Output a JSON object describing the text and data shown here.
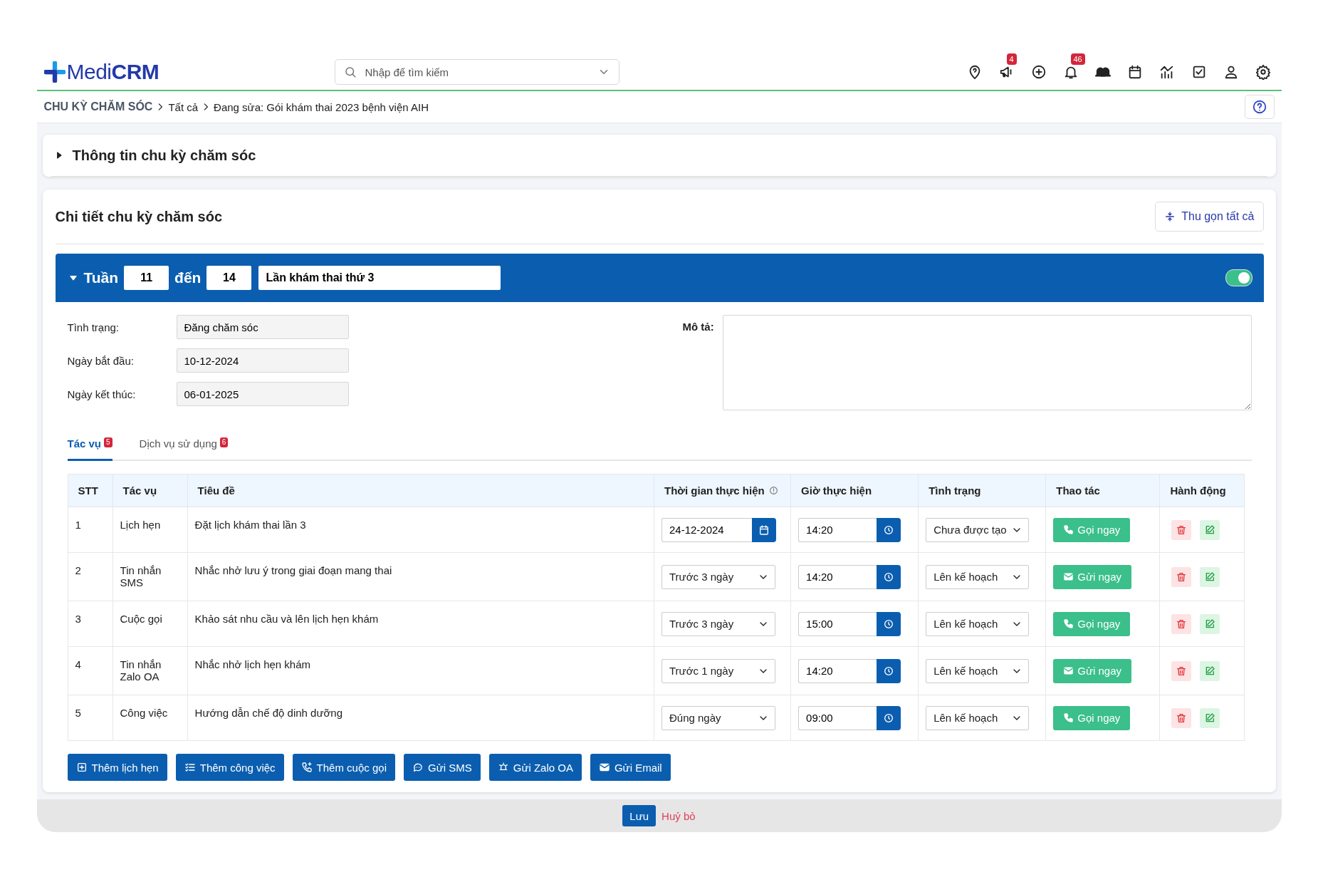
{
  "header": {
    "logo": "Medi**CRM**",
    "search": {
      "placeholder": "Nhập để tìm kiếm"
    },
    "announcement_badge": "4",
    "notification_badge": "46"
  },
  "breadcrumb": [
    {
      "text": "CHU KỲ CHĂM SÓC",
      "kind": "root"
    },
    {
      "text": "Tất cả",
      "kind": "link"
    },
    {
      "text": "Đang sửa: Gói khám thai 2023 bệnh viện AIH",
      "kind": "current"
    }
  ],
  "info_section": {
    "title": "Thông tin chu kỳ chăm sóc",
    "expanded": false
  },
  "detail_section": {
    "title": "Chi tiết chu kỳ chăm sóc",
    "collapse_button": "Thu gọn tất cả"
  },
  "stage": {
    "expanded": true,
    "week_label": "Tuần",
    "from_week": "11",
    "to_label": "đến",
    "to_week": "14",
    "name": "Lần khám thai thứ 3",
    "on": true,
    "fields": [
      {
        "label": "Tình trạng:",
        "value": "Đăng chăm sóc"
      },
      {
        "label": "Ngày bắt đầu:",
        "value": "10-12-2024"
      },
      {
        "label": "Ngày kết thúc:",
        "value": "06-01-2025"
      }
    ],
    "description_label": "Mô tả:"
  },
  "tabs": [
    {
      "label": "Tác vụ",
      "badge": "5",
      "selected": true
    },
    {
      "label": "Dịch vụ sử dụng",
      "badge": "6",
      "selected": false
    }
  ],
  "table": {
    "columns": [
      "STT",
      "Tác vụ",
      "Tiêu đề",
      "Thời gian thực hiện",
      "Giờ thực hiện",
      "Tình trạng",
      "Thao tác",
      "Hành động"
    ],
    "rows": [
      {
        "stt": "1",
        "task": "Lịch hẹn",
        "title": "Đặt lịch khám thai lần 3",
        "time": {
          "kind": "date",
          "value": "24-12-2024"
        },
        "hour": "14:20",
        "status": "Chưa được tạo",
        "action": {
          "kind": "call",
          "label": "Gọi ngay"
        }
      },
      {
        "stt": "2",
        "task": "Tin nhắn SMS",
        "title": "Nhắc nhở lưu ý trong giai đoạn mang thai",
        "time": {
          "kind": "select",
          "value": "Trước 3 ngày"
        },
        "hour": "14:20",
        "status": "Lên kế hoạch",
        "action": {
          "kind": "send",
          "label": "Gửi ngay"
        }
      },
      {
        "stt": "3",
        "task": "Cuộc gọi",
        "title": "Khảo sát nhu cầu và lên lịch hẹn khám",
        "time": {
          "kind": "select",
          "value": "Trước 3 ngày"
        },
        "hour": "15:00",
        "status": "Lên kế hoạch",
        "action": {
          "kind": "call",
          "label": "Gọi ngay"
        }
      },
      {
        "stt": "4",
        "task": "Tin nhắn Zalo OA",
        "title": "Nhắc nhở lịch hẹn khám",
        "time": {
          "kind": "select",
          "value": "Trước 1 ngày"
        },
        "hour": "14:20",
        "status": "Lên kế hoạch",
        "action": {
          "kind": "send",
          "label": "Gửi ngay"
        }
      },
      {
        "stt": "5",
        "task": "Công việc",
        "title": "Hướng dẫn chế độ dinh dưỡng",
        "time": {
          "kind": "select",
          "value": "Đúng ngày"
        },
        "hour": "09:00",
        "status": "Lên kế hoạch",
        "action": {
          "kind": "call",
          "label": "Gọi ngay"
        }
      }
    ]
  },
  "add_buttons": [
    {
      "kind": "appointment",
      "label": "Thêm lịch hẹn"
    },
    {
      "kind": "task",
      "label": "Thêm công việc"
    },
    {
      "kind": "call",
      "label": "Thêm cuộc gọi"
    },
    {
      "kind": "sms",
      "label": "Gửi SMS"
    },
    {
      "kind": "zalo",
      "label": "Gửi Zalo OA"
    },
    {
      "kind": "email",
      "label": "Gửi Email"
    }
  ],
  "footer": {
    "save": "Lưu",
    "cancel": "Huỷ bỏ"
  }
}
